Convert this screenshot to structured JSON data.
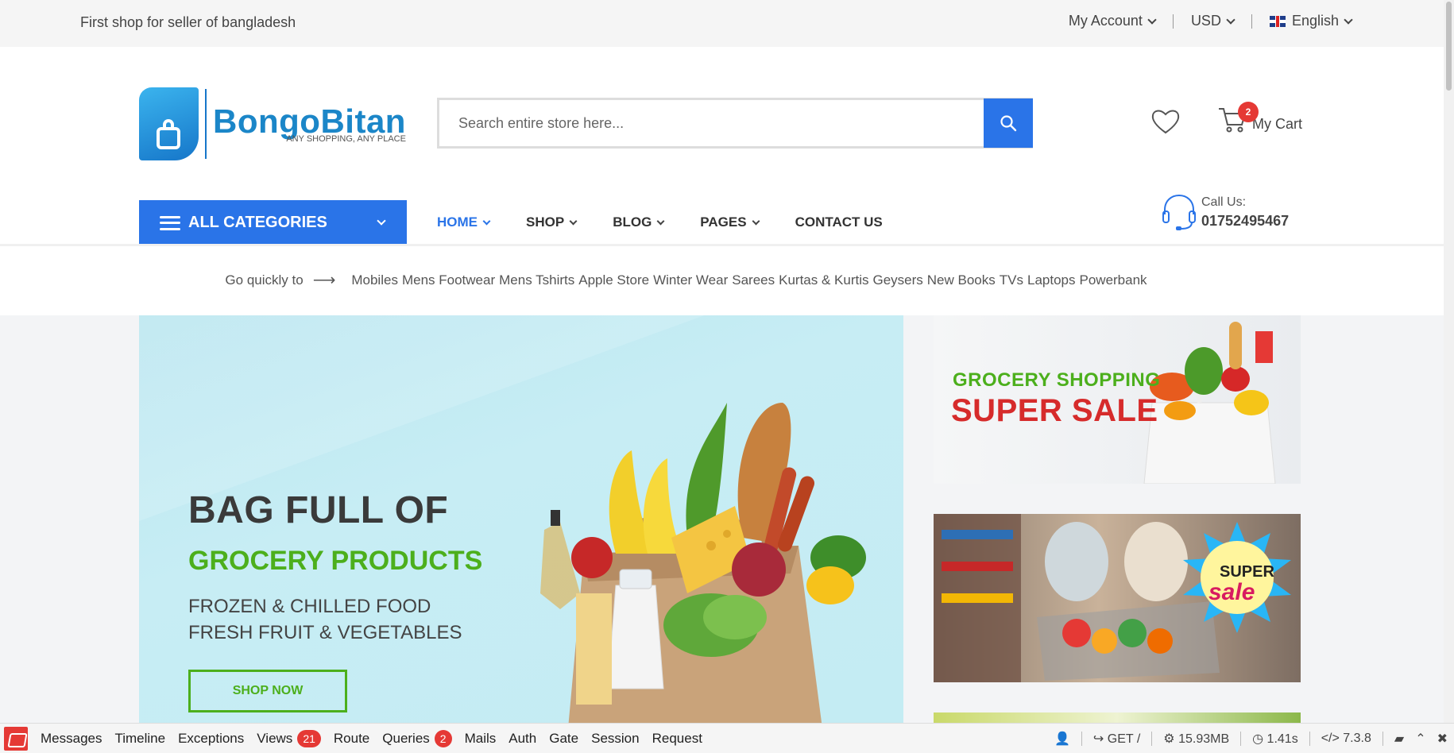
{
  "topbar": {
    "tagline": "First shop for seller of bangladesh",
    "account": "My Account",
    "currency": "USD",
    "language": "English"
  },
  "header": {
    "brand": "BongoBitan",
    "slogan": "ANY SHOPPING, ANY PLACE",
    "search_placeholder": "Search entire store here...",
    "cart_count": "2",
    "cart_label": "My Cart"
  },
  "nav": {
    "all_categories": "ALL CATEGORIES",
    "items": [
      {
        "label": "HOME"
      },
      {
        "label": "SHOP"
      },
      {
        "label": "BLOG"
      },
      {
        "label": "PAGES"
      },
      {
        "label": "CONTACT US"
      }
    ],
    "call_label": "Call Us:",
    "call_number": "01752495467"
  },
  "quick": {
    "label": "Go quickly to",
    "links": [
      "Mobiles",
      "Mens Footwear",
      "Mens Tshirts",
      "Apple Store",
      "Winter Wear",
      "Sarees",
      "Kurtas & Kurtis",
      "Geysers",
      "New Books",
      "TVs",
      "Laptops",
      "Powerbank"
    ]
  },
  "hero": {
    "line1": "BAG FULL OF",
    "line2": "GROCERY PRODUCTS",
    "line3": "FROZEN & CHILLED FOOD",
    "line4": "FRESH FRUIT & VEGETABLES",
    "cta": "SHOP NOW"
  },
  "side_banners": {
    "banner1_line1": "GROCERY SHOPPING",
    "banner1_line2": "SUPER SALE",
    "banner2_line1": "SUPER",
    "banner2_line2": "sale"
  },
  "debugbar": {
    "tabs": [
      {
        "label": "Messages",
        "count": ""
      },
      {
        "label": "Timeline",
        "count": ""
      },
      {
        "label": "Exceptions",
        "count": ""
      },
      {
        "label": "Views",
        "count": "21"
      },
      {
        "label": "Route",
        "count": ""
      },
      {
        "label": "Queries",
        "count": "2"
      },
      {
        "label": "Mails",
        "count": ""
      },
      {
        "label": "Auth",
        "count": ""
      },
      {
        "label": "Gate",
        "count": ""
      },
      {
        "label": "Session",
        "count": ""
      },
      {
        "label": "Request",
        "count": ""
      }
    ],
    "method": "GET /",
    "memory": "15.93MB",
    "time": "1.41s",
    "php": "7.3.8"
  },
  "colors": {
    "accent": "#2a74e8",
    "green": "#4caf1c",
    "badge": "#e53935"
  }
}
